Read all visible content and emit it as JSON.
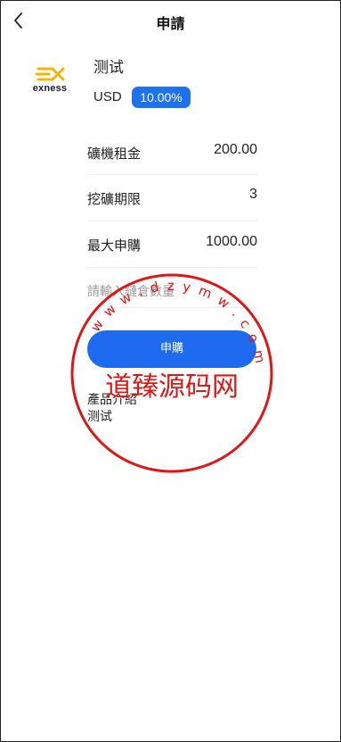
{
  "header": {
    "title": "申請"
  },
  "product": {
    "logo_text": "exness",
    "name": "测试",
    "currency": "USD",
    "rate": "10.00%"
  },
  "details": [
    {
      "label": "礦機租金",
      "value": "200.00"
    },
    {
      "label": "挖礦期限",
      "value": "3"
    },
    {
      "label": "最大申購",
      "value": "1000.00"
    }
  ],
  "form": {
    "amount_placeholder": "請輸入鏈倉數量",
    "submit_label": "申購"
  },
  "intro": {
    "title": "產品介紹",
    "text": "测试"
  },
  "watermark": {
    "text": "道臻源码网",
    "ring_text": "w w w . d z y m w . c o m",
    "color": "#e01616"
  },
  "colors": {
    "accent": "#1e6af0",
    "badge": "#1e72f0",
    "logo_mark": "#f2b705"
  }
}
